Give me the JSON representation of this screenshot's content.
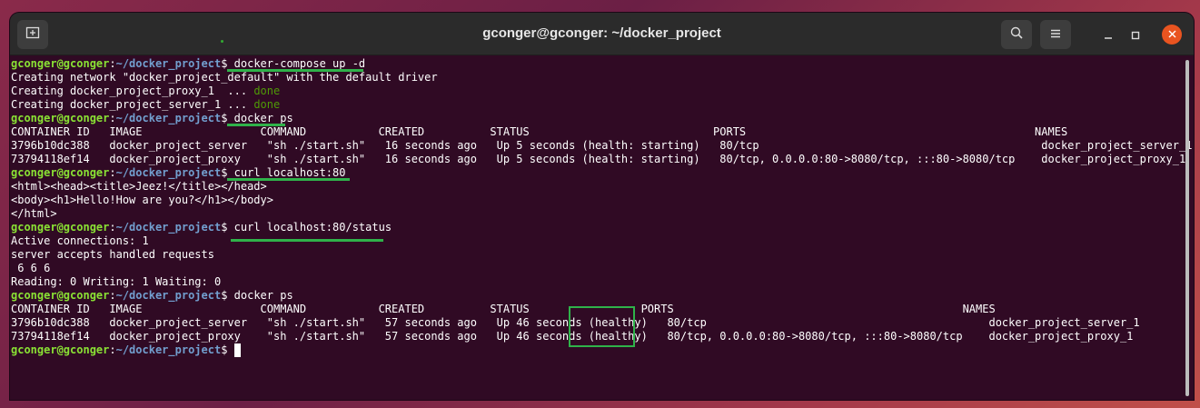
{
  "window": {
    "title": "gconger@gconger: ~/docker_project",
    "icons": {
      "new_tab": "new-tab-icon",
      "search": "search-icon",
      "menu": "hamburger-icon",
      "minimize": "minimize-icon",
      "maximize": "maximize-icon",
      "close": "close-icon"
    }
  },
  "prompt": {
    "user": "gconger@gconger",
    "sep": ":",
    "path": "~/docker_project",
    "sym": "$ "
  },
  "lines": [
    {
      "type": "cmd",
      "cmd": "docker-compose up -d"
    },
    {
      "type": "out",
      "text": "Creating network \"docker_project_default\" with the default driver"
    },
    {
      "type": "status",
      "text": "Creating docker_project_proxy_1  ... ",
      "status": "done"
    },
    {
      "type": "status",
      "text": "Creating docker_project_server_1 ... ",
      "status": "done"
    },
    {
      "type": "cmd",
      "cmd": "docker ps"
    },
    {
      "type": "out",
      "text": "CONTAINER ID   IMAGE                  COMMAND           CREATED          STATUS                            PORTS                                            NAMES"
    },
    {
      "type": "out",
      "text": "3796b10dc388   docker_project_server   \"sh ./start.sh\"   16 seconds ago   Up 5 seconds (health: starting)   80/tcp                                           docker_project_server_1"
    },
    {
      "type": "out",
      "text": "73794118ef14   docker_project_proxy    \"sh ./start.sh\"   16 seconds ago   Up 5 seconds (health: starting)   80/tcp, 0.0.0.0:80->8080/tcp, :::80->8080/tcp    docker_project_proxy_1"
    },
    {
      "type": "cmd",
      "cmd": "curl localhost:80"
    },
    {
      "type": "out",
      "text": "<html><head><title>Jeez!</title></head>"
    },
    {
      "type": "out",
      "text": "<body><h1>Hello!How are you?</h1></body>"
    },
    {
      "type": "out",
      "text": "</html>"
    },
    {
      "type": "cmd",
      "cmd": "curl localhost:80/status"
    },
    {
      "type": "out",
      "text": "Active connections: 1"
    },
    {
      "type": "out",
      "text": "server accepts handled requests"
    },
    {
      "type": "out",
      "text": " 6 6 6"
    },
    {
      "type": "out",
      "text": "Reading: 0 Writing: 1 Waiting: 0"
    },
    {
      "type": "cmd",
      "cmd": "docker ps"
    },
    {
      "type": "out",
      "text": "CONTAINER ID   IMAGE                  COMMAND           CREATED          STATUS                 PORTS                                            NAMES"
    },
    {
      "type": "out",
      "text": "3796b10dc388   docker_project_server   \"sh ./start.sh\"   57 seconds ago   Up 46 seconds (healthy)   80/tcp                                           docker_project_server_1"
    },
    {
      "type": "out",
      "text": "73794118ef14   docker_project_proxy    \"sh ./start.sh\"   57 seconds ago   Up 46 seconds (healthy)   80/tcp, 0.0.0.0:80->8080/tcp, :::80->8080/tcp    docker_project_proxy_1"
    },
    {
      "type": "cursor"
    }
  ],
  "colors": {
    "background": "#300a24",
    "user": "#8ae234",
    "path": "#729fcf",
    "done": "#4e9a06",
    "highlight": "#2fb24a",
    "close": "#e95420"
  }
}
